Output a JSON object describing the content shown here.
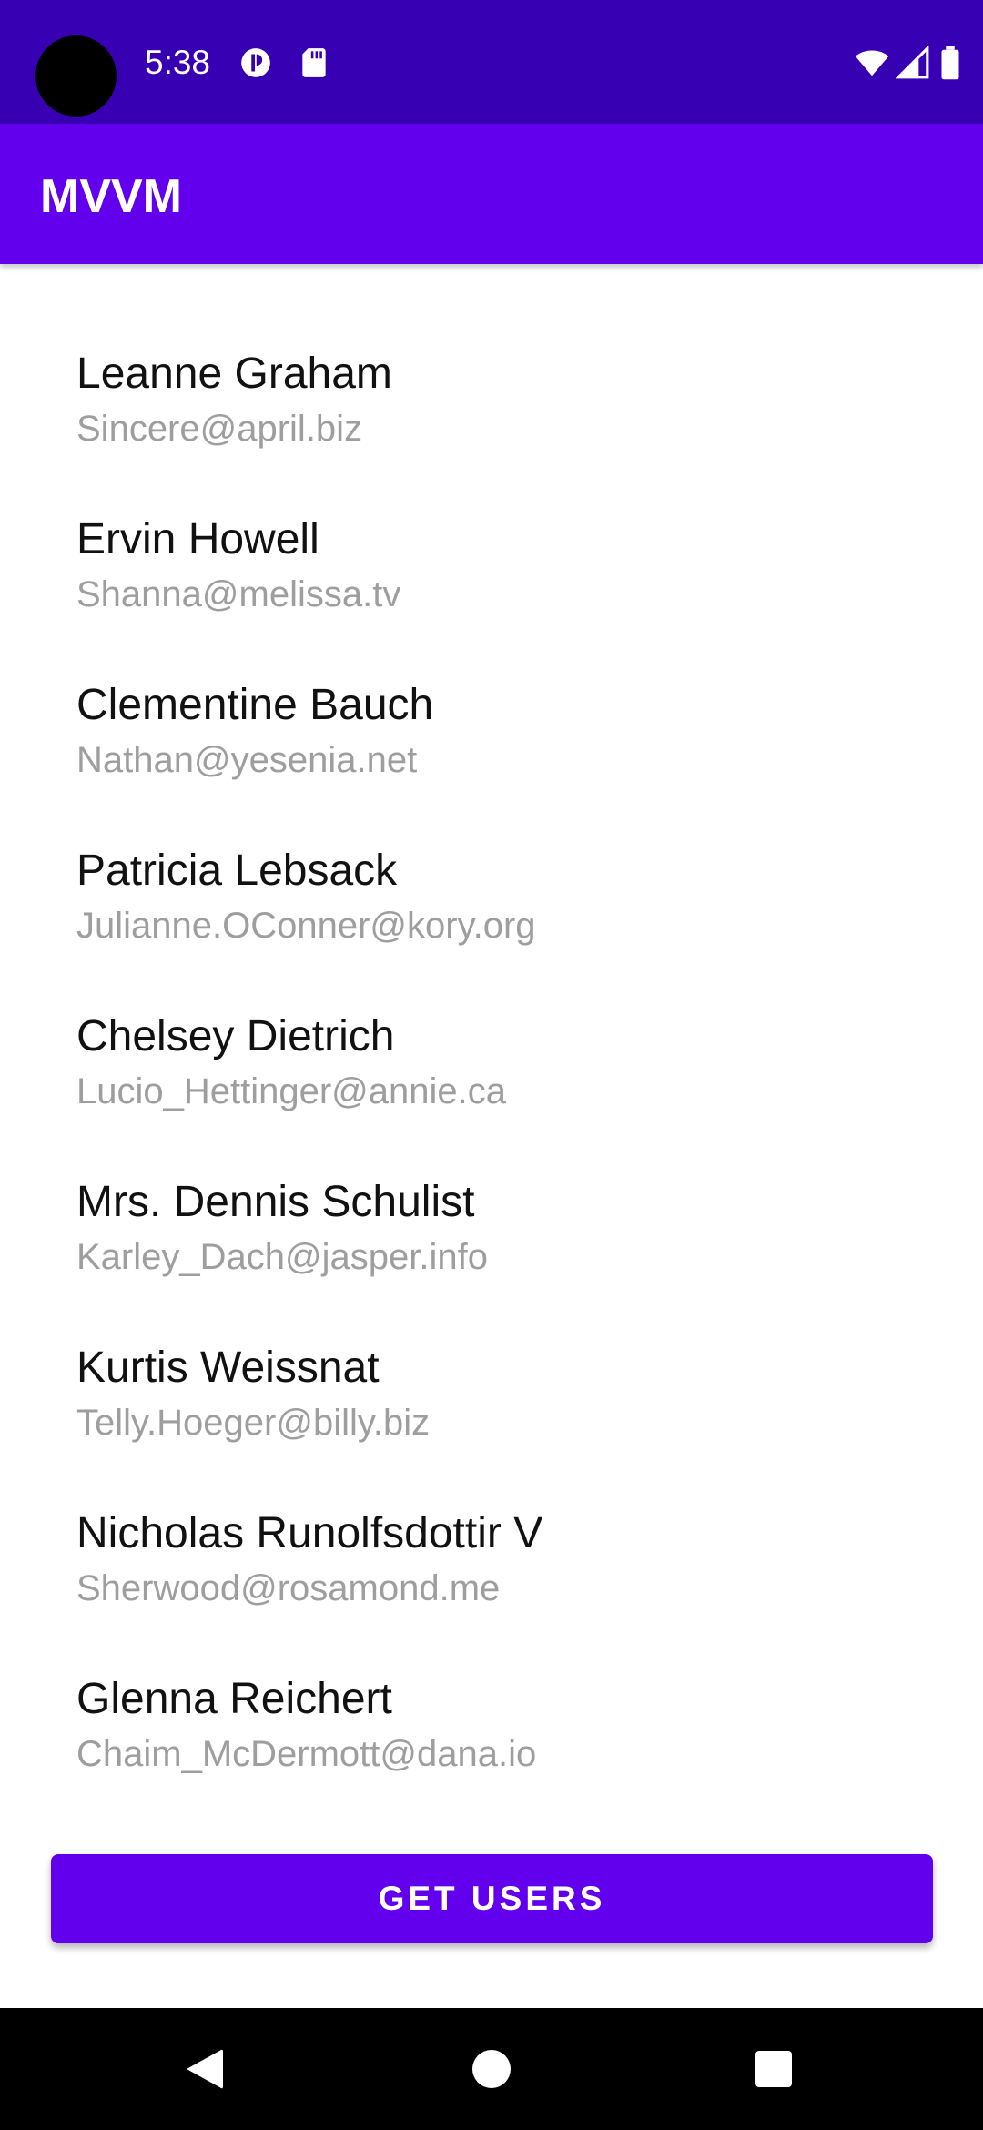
{
  "status_bar": {
    "time": "5:38",
    "icons_left": [
      "data-saver-icon",
      "sd-card-icon"
    ],
    "icons_right": [
      "wifi-icon",
      "cell-signal-icon",
      "battery-icon"
    ]
  },
  "app_bar": {
    "title": "MVVM"
  },
  "users": [
    {
      "name": "Leanne Graham",
      "email": "Sincere@april.biz"
    },
    {
      "name": "Ervin Howell",
      "email": "Shanna@melissa.tv"
    },
    {
      "name": "Clementine Bauch",
      "email": "Nathan@yesenia.net"
    },
    {
      "name": "Patricia Lebsack",
      "email": "Julianne.OConner@kory.org"
    },
    {
      "name": "Chelsey Dietrich",
      "email": "Lucio_Hettinger@annie.ca"
    },
    {
      "name": "Mrs. Dennis Schulist",
      "email": "Karley_Dach@jasper.info"
    },
    {
      "name": "Kurtis Weissnat",
      "email": "Telly.Hoeger@billy.biz"
    },
    {
      "name": "Nicholas Runolfsdottir V",
      "email": "Sherwood@rosamond.me"
    },
    {
      "name": "Glenna Reichert",
      "email": "Chaim_McDermott@dana.io"
    }
  ],
  "button": {
    "label": "GET USERS"
  },
  "nav_bar": {
    "buttons": [
      "back-icon",
      "home-icon",
      "recents-icon"
    ]
  },
  "colors": {
    "status_bar": "#3700b3",
    "primary": "#6200ee",
    "name_text": "#111111",
    "email_text": "#9e9e9e"
  }
}
